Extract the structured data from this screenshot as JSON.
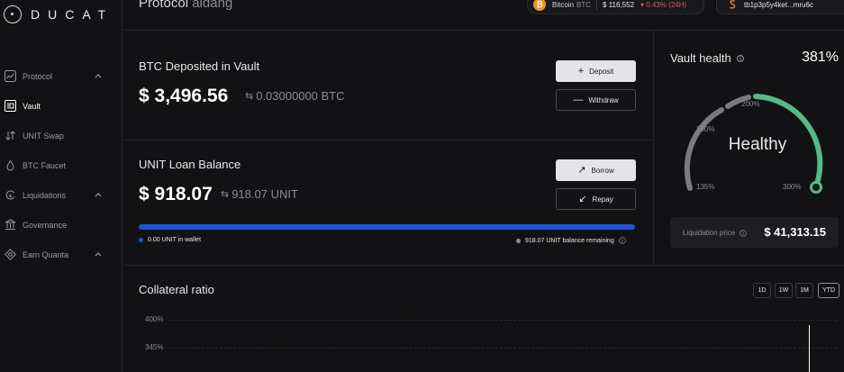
{
  "app": {
    "logo_text": "DUCAT"
  },
  "header": {
    "title": "Protocol",
    "subtitle": "aidang",
    "ticker": {
      "name": "Bitcoin",
      "symbol": "BTC",
      "price": "$ 116,552",
      "change": "▾ 0.43% (24H)"
    },
    "wallet": "tb1p3p5y4ket...mru6c"
  },
  "sidebar": {
    "items": [
      {
        "label": "Protocol",
        "icon": "chart-icon",
        "chevron": true
      },
      {
        "label": "Vault",
        "icon": "vault-icon",
        "active": true
      },
      {
        "label": "UNIT Swap",
        "icon": "swap-icon"
      },
      {
        "label": "BTC Faucet",
        "icon": "faucet-icon"
      },
      {
        "label": "Liquidations",
        "icon": "liquidations-icon",
        "chevron": true
      },
      {
        "label": "Governance",
        "icon": "governance-icon"
      },
      {
        "label": "Earn Quanta",
        "icon": "quanta-icon",
        "chevron": true
      }
    ]
  },
  "vault": {
    "title": "BTC Deposited in Vault",
    "usd": "$ 3,496.56",
    "btc": "0.03000000 BTC",
    "deposit_label": "Deposit",
    "withdraw_label": "Withdraw"
  },
  "loan": {
    "title": "UNIT Loan Balance",
    "usd": "$ 918.07",
    "unit": "918.07 UNIT",
    "borrow_label": "Borrow",
    "repay_label": "Repay",
    "in_wallet": "0.00 UNIT in wallet",
    "remaining": "918.07 UNIT balance remaining",
    "remaining_fraction": 1.0
  },
  "health": {
    "title": "Vault health",
    "percent": "381%",
    "status": "Healthy",
    "labels": [
      "135%",
      "160%",
      "200%",
      "300%"
    ],
    "liq_label": "Liquidation price",
    "liq_value": "$ 41,313.15",
    "colors": {
      "healthy": "#57b88a",
      "track": "#7a7a80"
    }
  },
  "ratio": {
    "title": "Collateral ratio",
    "ranges": [
      "1D",
      "1W",
      "1M",
      "YTD"
    ],
    "selected_range": "YTD",
    "y_ticks": [
      "400%",
      "345%"
    ]
  },
  "colors": {
    "accent_blue": "#1f53d6",
    "negative": "#e0555b",
    "btc_orange": "#f39321"
  }
}
